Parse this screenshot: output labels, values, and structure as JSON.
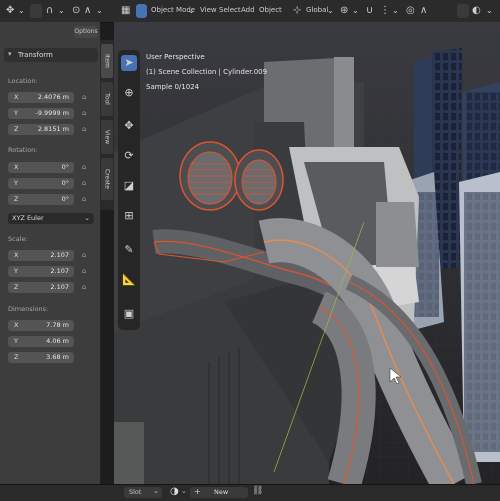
{
  "header": {
    "mode_label": "Object Mode",
    "menu": [
      "View",
      "Select",
      "Add",
      "Object"
    ],
    "transform_orientation": "Global"
  },
  "sidebar": {
    "options_label": "Options",
    "panel_title": "Transform",
    "location_label": "Location:",
    "location": [
      {
        "axis": "X",
        "value": "2.4076 m"
      },
      {
        "axis": "Y",
        "value": "-9.9999 m"
      },
      {
        "axis": "Z",
        "value": "2.8151 m"
      }
    ],
    "rotation_label": "Rotation:",
    "rotation": [
      {
        "axis": "X",
        "value": "0°"
      },
      {
        "axis": "Y",
        "value": "0°"
      },
      {
        "axis": "Z",
        "value": "0°"
      }
    ],
    "rotation_mode": "XYZ Euler",
    "scale_label": "Scale:",
    "scale": [
      {
        "axis": "X",
        "value": "2.107"
      },
      {
        "axis": "Y",
        "value": "2.107"
      },
      {
        "axis": "Z",
        "value": "2.107"
      }
    ],
    "dimensions_label": "Dimensions:",
    "dimensions": [
      {
        "axis": "X",
        "value": "7.78 m"
      },
      {
        "axis": "Y",
        "value": "4.06 m"
      },
      {
        "axis": "Z",
        "value": "3.68 m"
      }
    ],
    "tabs": [
      "Item",
      "Tool",
      "View",
      "Create"
    ]
  },
  "viewport": {
    "perspective": "User Perspective",
    "collection": "(1) Scene Collection | Cylinder.009",
    "sample": "Sample 0/1024"
  },
  "bottom": {
    "slot_label": "Slot",
    "new_label": "New"
  },
  "colors": {
    "accent": "#4772b3",
    "selection_outline": "#e0542b",
    "active_outline": "#f08a4b"
  },
  "icons": {
    "select_tool": "cursor-icon",
    "cursor_tool": "3d-cursor-icon",
    "move_tool": "move-icon",
    "rotate_tool": "rotate-icon",
    "scale_tool": "scale-icon",
    "transform_tool": "transform-icon",
    "annotate_tool": "annotate-icon",
    "measure_tool": "measure-icon",
    "add_cube_tool": "add-cube-icon"
  }
}
